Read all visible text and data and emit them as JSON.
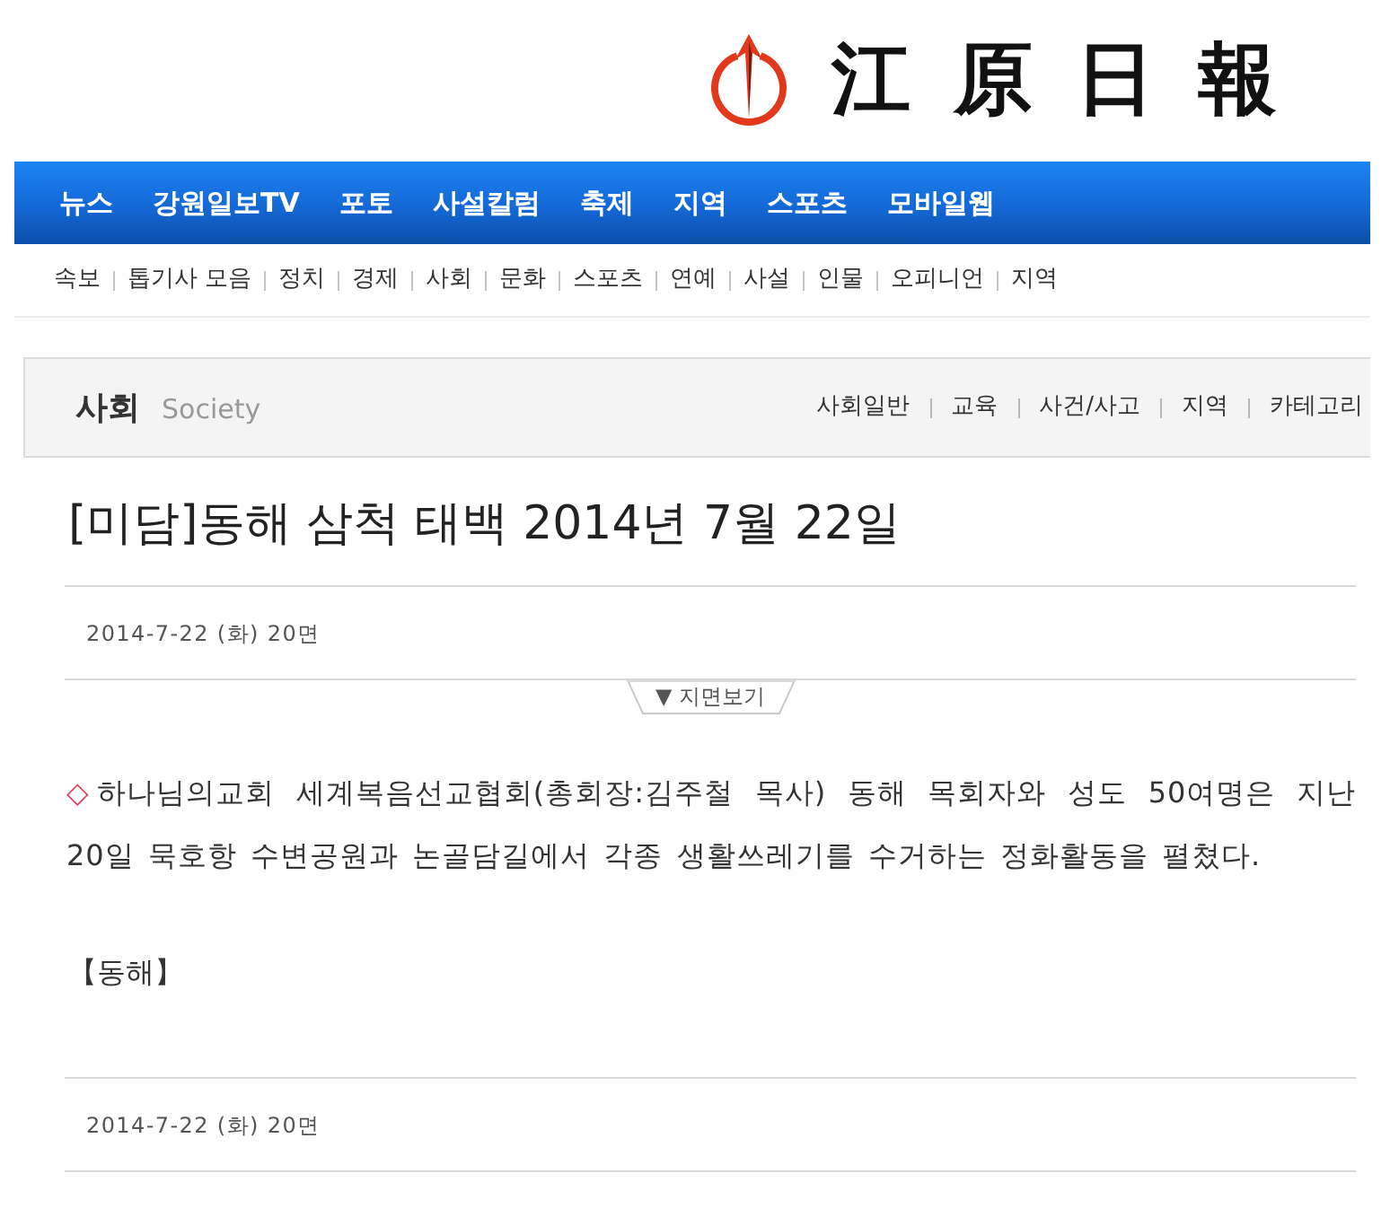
{
  "header": {
    "logo_text": "江原日報"
  },
  "main_nav": [
    "뉴스",
    "강원일보TV",
    "포토",
    "사설칼럼",
    "축제",
    "지역",
    "스포츠",
    "모바일웹"
  ],
  "sub_nav": [
    "속보",
    "톱기사 모음",
    "정치",
    "경제",
    "사회",
    "문화",
    "스포츠",
    "연예",
    "사설",
    "인물",
    "오피니언",
    "지역"
  ],
  "section": {
    "title": "사회",
    "subtitle": "Society",
    "links": [
      "사회일반",
      "교육",
      "사건/사고",
      "지역",
      "카테고리"
    ]
  },
  "article": {
    "title": "[미담]동해 삼척 태백 2014년 7월 22일",
    "date_top": "2014-7-22 (화) 20면",
    "page_view_button": "▼ 지면보기",
    "bullet": "◇",
    "body": "하나님의교회 세계복음선교협회(총회장:김주철 목사) 동해 목회자와 성도 50여명은 지난 20일 묵호항 수변공원과 논골담길에서 각종 생활쓰레기를 수거하는 정화활동을 펼쳤다.",
    "dateline": "【동해】",
    "date_bottom": "2014-7-22 (화) 20면"
  }
}
